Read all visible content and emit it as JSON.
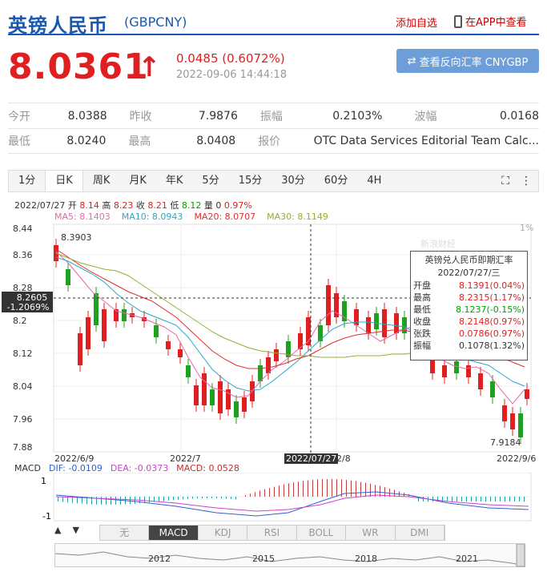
{
  "header": {
    "title": "英镑人民币",
    "code": "(GBPCNY)",
    "add_watch": "添加自选",
    "view_app": "在APP中查看"
  },
  "quote": {
    "price": "8.0361",
    "change": "0.0485 (0.6072%)",
    "timestamp": "2022-09-06 14:44:18",
    "reverse_btn": "查看反向汇率 CNYGBP",
    "direction": "up",
    "accent": "#e02020"
  },
  "stats": {
    "row1": [
      {
        "label": "今开",
        "value": "8.0388"
      },
      {
        "label": "昨收",
        "value": "7.9876"
      },
      {
        "label": "振幅",
        "value": "0.2103%"
      },
      {
        "label": "波幅",
        "value": "0.0168"
      }
    ],
    "row2": [
      {
        "label": "最低",
        "value": "8.0240"
      },
      {
        "label": "最高",
        "value": "8.0408"
      },
      {
        "label": "报价",
        "value": "OTC Data Services Editorial Team Calc..."
      }
    ]
  },
  "tabs": [
    "1分",
    "日K",
    "周K",
    "月K",
    "年K",
    "5分",
    "15分",
    "30分",
    "60分",
    "4H"
  ],
  "active_tab": "日K",
  "bar_info": {
    "date": "2022/07/27",
    "open_label": "开",
    "open": "8.14",
    "high_label": "高",
    "high": "8.23",
    "close_label": "收",
    "close": "8.21",
    "low_label": "低",
    "low": "8.12",
    "vol_label": "量",
    "vol": "0",
    "pct": "0.97%"
  },
  "ma": {
    "ma5": "MA5: 8.1403",
    "ma10": "MA10: 8.0943",
    "ma20": "MA20: 8.0707",
    "ma30": "MA30: 8.1149"
  },
  "y_axis": [
    "8.44",
    "8.36",
    "8.28",
    "8.2",
    "8.12",
    "8.04",
    "7.96",
    "7.88"
  ],
  "crosshair": {
    "value": "8.2605",
    "pct": "-1.2069%",
    "date": "2022/07/27"
  },
  "labels": {
    "max": "8.3903",
    "min": "7.9184",
    "right_pct": "1%"
  },
  "x_axis": {
    "start": "2022/6/9",
    "mid": "2022/7",
    "after": "2/8",
    "end": "2022/9/6"
  },
  "tooltip": {
    "title": "英镑兑人民币即期汇率",
    "date": "2022/07/27/三",
    "rows": [
      {
        "k": "开盘",
        "v": "8.1391(0.04%)",
        "c": "r"
      },
      {
        "k": "最高",
        "v": "8.2315(1.17%)",
        "c": "r"
      },
      {
        "k": "最低",
        "v": "8.1237(-0.15%)",
        "c": "g"
      },
      {
        "k": "收盘",
        "v": "8.2148(0.97%)",
        "c": "r"
      },
      {
        "k": "张跌",
        "v": "0.0786(0.97%)",
        "c": "r"
      },
      {
        "k": "振幅",
        "v": "0.1078(1.32%)",
        "c": "k"
      }
    ]
  },
  "macd": {
    "label": "MACD",
    "dif": "DIF: -0.0109",
    "dea": "DEA: -0.0373",
    "macd": "MACD: 0.0528",
    "ymax": "1",
    "ymin": "-1"
  },
  "indicators": [
    "无",
    "MACD",
    "KDJ",
    "RSI",
    "BOLL",
    "WR",
    "DMI"
  ],
  "active_indicator": "MACD",
  "nav_years": [
    "2012",
    "2015",
    "2018",
    "2021"
  ],
  "watermark": "新浪财经"
}
